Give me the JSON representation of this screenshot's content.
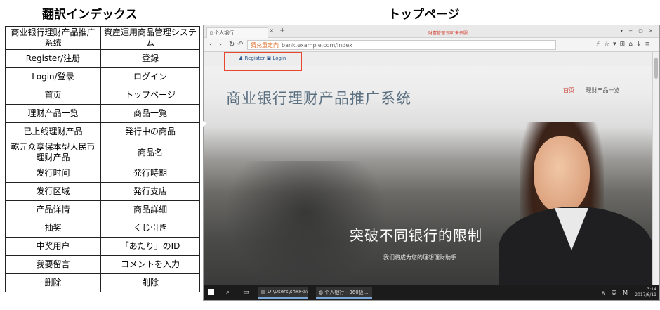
{
  "left_title": "翻訳インデックス",
  "right_title": "トップページ",
  "table_rows": [
    {
      "zh": "商业银行理财产品推广系统",
      "ja": "資産運用商品管理システム"
    },
    {
      "zh": "Register/注册",
      "ja": "登録"
    },
    {
      "zh": "Login/登录",
      "ja": "ログイン"
    },
    {
      "zh": "首页",
      "ja": "トップページ"
    },
    {
      "zh": "理财产品一览",
      "ja": "商品一覧"
    },
    {
      "zh": "已上线理财产品",
      "ja": "発行中の商品"
    },
    {
      "zh": "乾元众享保本型人民币理财产品",
      "ja": "商品名"
    },
    {
      "zh": "发行时间",
      "ja": "発行時期"
    },
    {
      "zh": "发行区域",
      "ja": "発行支店"
    },
    {
      "zh": "产品详情",
      "ja": "商品詳細"
    },
    {
      "zh": "抽奖",
      "ja": "くじ引き"
    },
    {
      "zh": "中奖用户",
      "ja": "「あたり」のID"
    },
    {
      "zh": "我要留言",
      "ja": "コメントを入力"
    },
    {
      "zh": "删除",
      "ja": "削除"
    }
  ],
  "browser": {
    "tab_title": "个人银行",
    "center_text": "财富管理专家 来云服",
    "url_tag": "猜兑重定向",
    "url": "bank.example.com/index",
    "window_controls": "▾ − ▢ ✕"
  },
  "site": {
    "register_label": "Register",
    "login_label": "Login",
    "title": "商业银行理财产品推广系统",
    "nav_home": "首页",
    "nav_products": "理财产品一览",
    "slogan": "突破不同银行的限制",
    "sub_slogan": "我们将成为您的理想理财助手"
  },
  "taskbar": {
    "explorer_label": "D:\\Users\\shxx-a\\D...",
    "browser_label": "个人银行 - 360极...",
    "tray_text": "∧ 英 M",
    "time": "3:14",
    "date": "2017/6/11"
  },
  "colors": {
    "highlight": "#e8472f",
    "site_title": "#5a6f80",
    "nav_active": "#c8372d"
  }
}
